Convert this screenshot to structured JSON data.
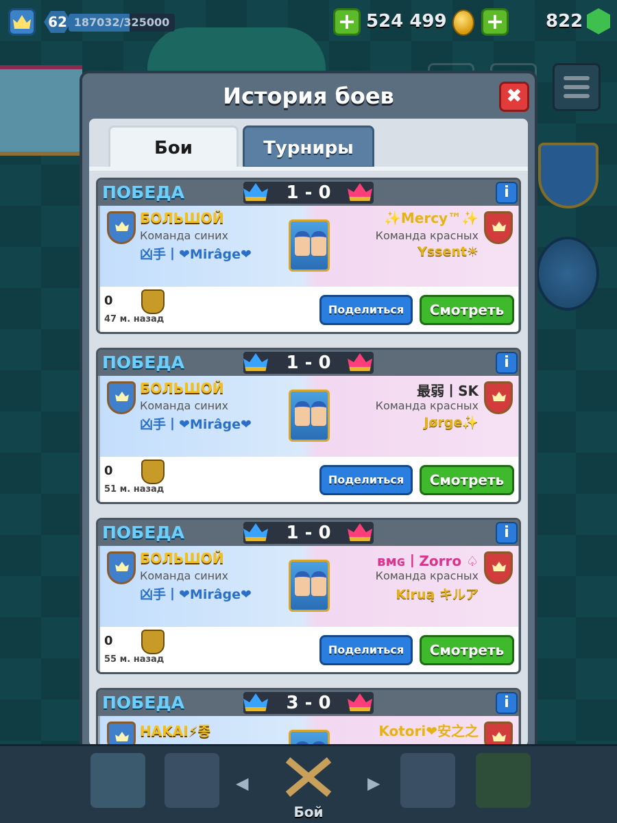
{
  "topbar": {
    "level": "62",
    "xp_text": "187032/325000",
    "xp_fraction": 0.575,
    "gold": "524 499",
    "gems": "822"
  },
  "modal": {
    "title": "История боев",
    "close_label": "✖",
    "tabs": [
      {
        "label": "Бои",
        "active": true
      },
      {
        "label": "Турниры",
        "active": false
      }
    ]
  },
  "battles": [
    {
      "result": "ПОБЕДА",
      "score": "1 - 0",
      "left": {
        "clan": "БОЛЬШОЙ",
        "team": "Команда синих",
        "player": "凶手丨❤Mirâge❤"
      },
      "right": {
        "clan": "✨Mercy™✨",
        "clan_color": "#e6b317",
        "team": "Команда красных",
        "player": "Yssent☀"
      },
      "trophies": "0",
      "time_ago": "47 м. назад",
      "share_label": "Поделиться",
      "watch_label": "Смотреть"
    },
    {
      "result": "ПОБЕДА",
      "score": "1 - 0",
      "left": {
        "clan": "БОЛЬШОЙ",
        "team": "Команда синих",
        "player": "凶手丨❤Mirâge❤"
      },
      "right": {
        "clan": "最弱丨SK",
        "clan_color": "#2b2b2b",
        "team": "Команда красных",
        "player": "Jørge✨"
      },
      "trophies": "0",
      "time_ago": "51 м. назад",
      "share_label": "Поделиться",
      "watch_label": "Смотреть"
    },
    {
      "result": "ПОБЕДА",
      "score": "1 - 0",
      "left": {
        "clan": "БОЛЬШОЙ",
        "team": "Команда синих",
        "player": "凶手丨❤Mirâge❤"
      },
      "right": {
        "clan": "ʙᴍɢ丨Zorro ♤",
        "clan_color": "#d8358c",
        "team": "Команда красных",
        "player": "Kiruą キルア"
      },
      "trophies": "0",
      "time_ago": "55 м. назад",
      "share_label": "Поделиться",
      "watch_label": "Смотреть"
    },
    {
      "result": "ПОБЕДА",
      "score": "3 - 0",
      "left": {
        "clan": "HAKAI⚡종",
        "team": "",
        "player": ""
      },
      "right": {
        "clan": "Kotori❤安之之",
        "clan_color": "#e6b317",
        "team": "",
        "player": ""
      },
      "trophies": "",
      "time_ago": "",
      "share_label": "",
      "watch_label": ""
    }
  ],
  "bottom_nav": {
    "active_label": "Бой"
  },
  "colors": {
    "result_win": "#6bd0ff",
    "share_button": "#2a7ee0",
    "watch_button": "#3fba2c",
    "blue_team": "#3aa2ff",
    "red_team": "#ff3d7a"
  }
}
